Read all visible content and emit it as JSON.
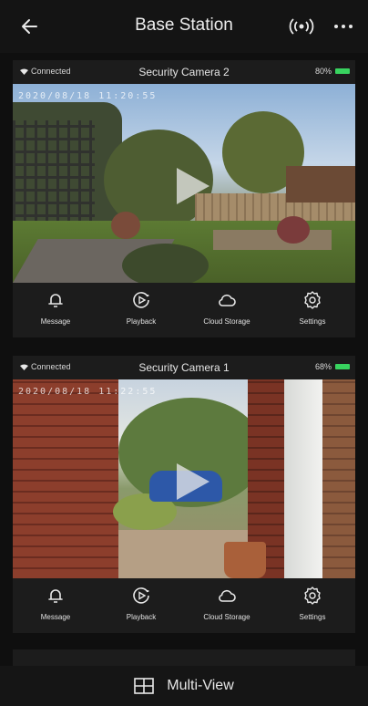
{
  "header": {
    "title": "Base Station",
    "back_icon": "arrow-left-icon",
    "signal_icon": "wireless-signal-icon",
    "more_icon": "more-horizontal-icon"
  },
  "cameras": [
    {
      "status": "Connected",
      "name": "Security Camera 2",
      "battery": "80%",
      "timestamp": "2020/08/18 11:20:55",
      "actions": [
        {
          "label": "Message",
          "icon": "bell-icon"
        },
        {
          "label": "Playback",
          "icon": "playback-icon"
        },
        {
          "label": "Cloud Storage",
          "icon": "cloud-icon"
        },
        {
          "label": "Settings",
          "icon": "gear-icon"
        }
      ]
    },
    {
      "status": "Connected",
      "name": "Security Camera 1",
      "battery": "68%",
      "timestamp": "2020/08/18 11:22:55",
      "actions": [
        {
          "label": "Message",
          "icon": "bell-icon"
        },
        {
          "label": "Playback",
          "icon": "playback-icon"
        },
        {
          "label": "Cloud Storage",
          "icon": "cloud-icon"
        },
        {
          "label": "Settings",
          "icon": "gear-icon"
        }
      ]
    }
  ],
  "bottom_bar": {
    "label": "Multi-View",
    "icon": "grid-view-icon"
  },
  "colors": {
    "battery": "#38d35f",
    "background": "#0f0f0f",
    "card": "#1c1c1c"
  }
}
